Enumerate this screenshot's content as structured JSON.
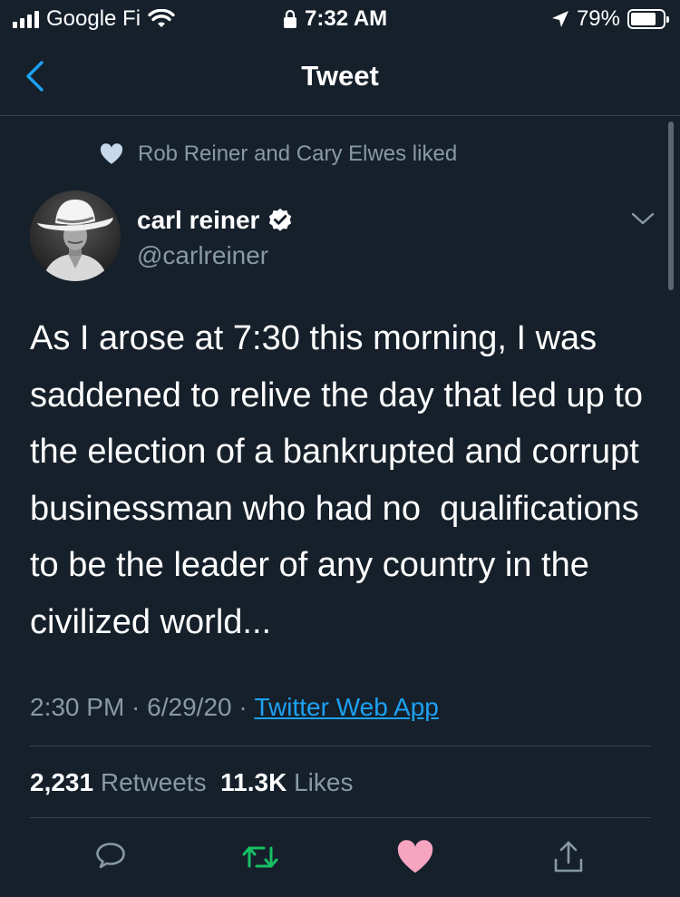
{
  "status_bar": {
    "carrier": "Google Fi",
    "time": "7:32 AM",
    "battery": "79%",
    "battery_level": 0.79
  },
  "nav": {
    "title": "Tweet"
  },
  "social_context": {
    "text": "Rob Reiner and Cary Elwes liked"
  },
  "author": {
    "display_name": "carl reiner",
    "handle": "@carlreiner",
    "verified": true
  },
  "tweet": {
    "text": "As I arose at 7:30 this morning, I was saddened to relive the day that led up to the election of a bankrupted and corrupt businessman who had no  qualifications to be the leader of any country in the civilized world...",
    "time": "2:30 PM",
    "date": "6/29/20",
    "separator": " · ",
    "source": "Twitter Web App"
  },
  "stats": {
    "retweets_count": "2,231",
    "retweets_label": "Retweets",
    "likes_count": "11.3K",
    "likes_label": "Likes"
  },
  "colors": {
    "background": "#15202b",
    "accent": "#1da1f2",
    "muted": "#8899a6",
    "retweet": "#17bf63",
    "like": "#e0245e",
    "liked_heart": "#f6a5c0"
  },
  "icons": {
    "back": "chevron-left-icon",
    "more": "chevron-down-icon",
    "verified": "verified-badge-icon",
    "reply": "reply-icon",
    "retweet": "retweet-icon",
    "like": "heart-icon",
    "share": "share-icon"
  }
}
